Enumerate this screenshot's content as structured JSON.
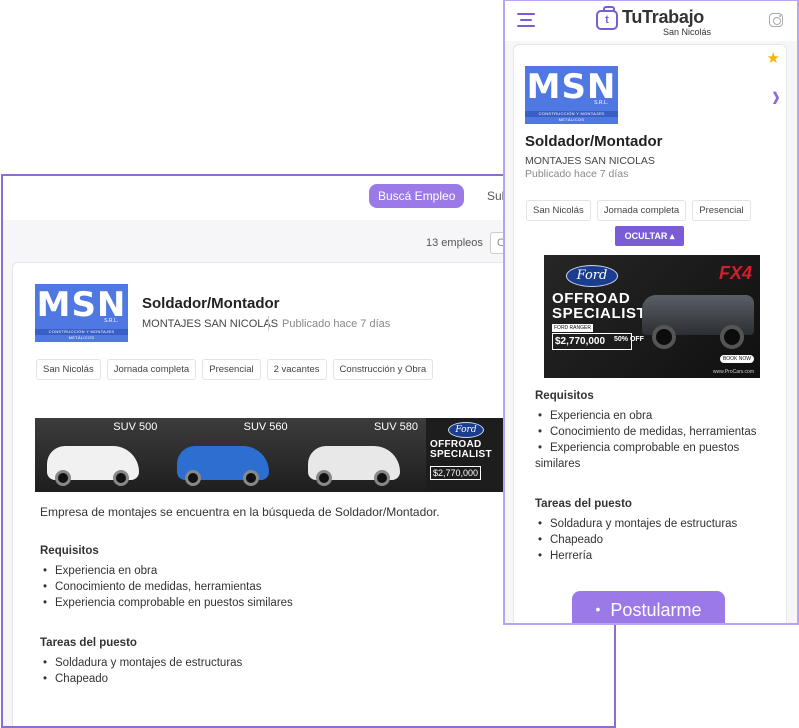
{
  "desktop": {
    "nav": {
      "search_jobs": "Buscá Empleo",
      "sub_partial": "Sub"
    },
    "results_count": "13 empleos",
    "order_partial": "O",
    "job": {
      "title": "Soldador/Montador",
      "company": "MONTAJES SAN NICOLAS",
      "posted": "Publicado hace 7 días",
      "chips": [
        "San Nicolás",
        "Jornada completa",
        "Presencial",
        "2 vacantes",
        "Construcción y Obra"
      ],
      "banner": {
        "cars": [
          {
            "label": "SUV 500",
            "color": "#f1f1f1"
          },
          {
            "label": "SUV 560",
            "color": "#2d6fd1"
          },
          {
            "label": "SUV 580",
            "color": "#e8e8e8"
          }
        ],
        "ford_logo": "Ford",
        "ford_text": "OFFROAD SPECIALIST",
        "ford_price": "$2,770,000"
      },
      "description": "Empresa de montajes se encuentra en la búsqueda de Soldador/Montador.",
      "requirements_title": "Requisitos",
      "requirements": [
        "Experiencia en obra",
        "Conocimiento de medidas, herramientas",
        "Experiencia comprobable en puestos similares"
      ],
      "tasks_title": "Tareas del puesto",
      "tasks": [
        "Soldadura y montajes de estructuras",
        "Chapeado"
      ]
    }
  },
  "logo": {
    "mark": "MSN",
    "suffix": "S.R.L.",
    "tagline": "CONSTRUCCIÓN Y MONTAJES METÁLICOS"
  },
  "mobile": {
    "brand": {
      "name": "TuTrabajo",
      "city": "San Nicolás",
      "icon_letter": "t"
    },
    "job": {
      "title": "Soldador/Montador",
      "company": "MONTAJES SAN NICOLAS",
      "posted": "Publicado hace 7 días",
      "chips": [
        "San Nicolás",
        "Jornada completa",
        "Presencial"
      ],
      "hide_button": "OCULTAR ▴",
      "banner": {
        "ford_logo": "Ford",
        "line1": "OFFROAD",
        "line2": "SPECIALIST",
        "sub": "FORD RANGER",
        "price": "$2,770,000",
        "discount": "50% OFF",
        "fx4": "FX4",
        "book": "BOOK NOW",
        "site": "www.ProCars.com"
      },
      "requirements_title": "Requisitos",
      "requirements": [
        "Experiencia en obra",
        "Conocimiento de medidas, herramientas",
        "Experiencia comprobable en puestos similares"
      ],
      "tasks_title": "Tareas del puesto",
      "tasks": [
        "Soldadura y montajes de estructuras",
        "Chapeado",
        "Herrería"
      ],
      "apply_button": "Postularme"
    }
  },
  "colors": {
    "accent": "#9b7ae8",
    "accent_dark": "#7a5cd6",
    "logo_blue": "#4f78e3",
    "star": "#f4b400"
  }
}
